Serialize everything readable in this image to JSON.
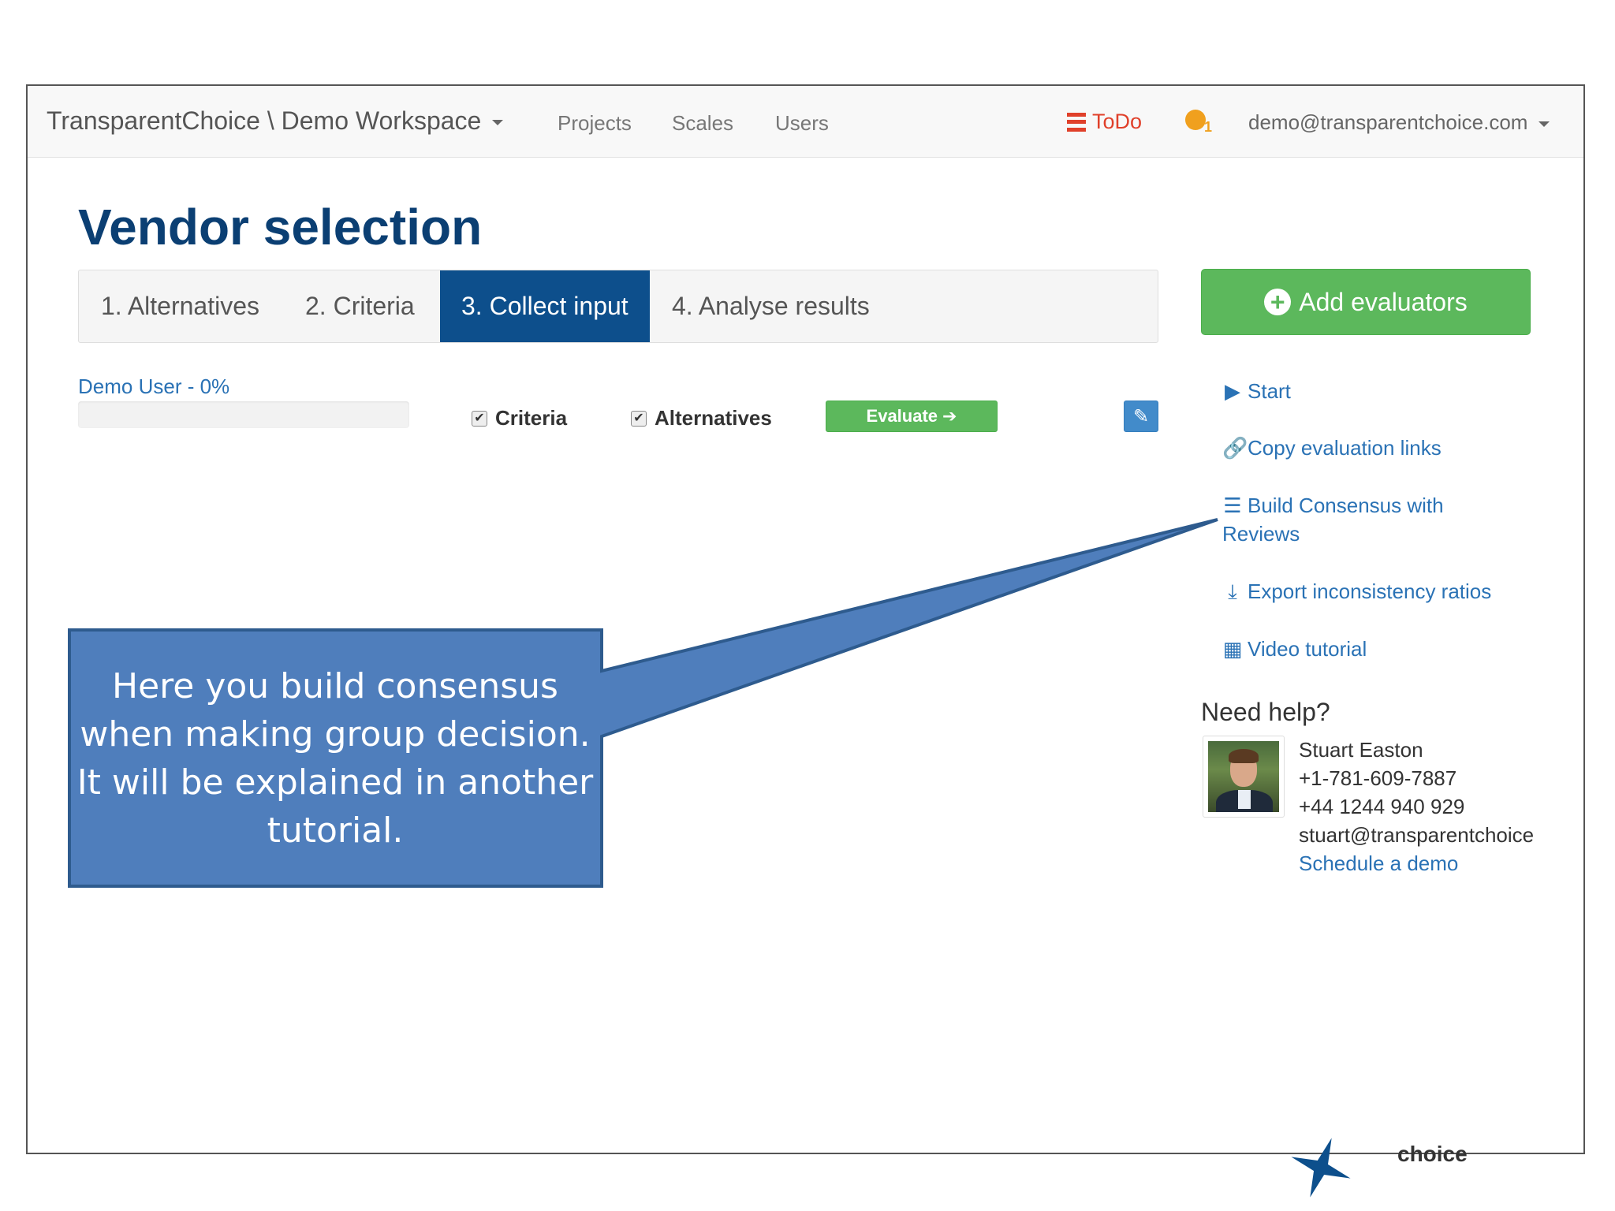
{
  "navbar": {
    "brand": "TransparentChoice \\ Demo Workspace",
    "links": [
      "Projects",
      "Scales",
      "Users"
    ],
    "todo_label": "ToDo",
    "notification_count": "1",
    "user_email": "demo@transparentchoice.com"
  },
  "page_title": "Vendor selection",
  "steps": [
    "1. Alternatives",
    "2. Criteria",
    "3. Collect input",
    "4. Analyse results"
  ],
  "active_step": "3. Collect input",
  "add_evaluators_label": "Add evaluators",
  "evaluator": {
    "name": "Demo User - 0%",
    "progress": 0,
    "criteria_label": "Criteria",
    "criteria_checked": true,
    "alternatives_label": "Alternatives",
    "alternatives_checked": true,
    "evaluate_label": "Evaluate"
  },
  "side_links": [
    {
      "label": "Start",
      "icon": "play-icon"
    },
    {
      "label": "Copy evaluation links",
      "icon": "link-icon"
    },
    {
      "label": "Build Consensus with Reviews",
      "icon": "list-icon"
    },
    {
      "label": "Export inconsistency ratios",
      "icon": "export-icon"
    },
    {
      "label": "Video tutorial",
      "icon": "film-icon"
    }
  ],
  "help": {
    "title": "Need help?",
    "name": "Stuart Easton",
    "phone_us": "+1-781-609-7887",
    "phone_uk": "+44 1244 940 929",
    "email": "stuart@transparentchoice",
    "schedule_label": "Schedule a demo"
  },
  "callout": {
    "text": "Here you build consensus when making group decision. It will be explained in another tutorial."
  },
  "footer_logo_text": "choice",
  "colors": {
    "title": "#0b3f73",
    "active_step": "#0d4f8c",
    "success": "#5cb85c",
    "link": "#2a72b5",
    "todo": "#e0402a",
    "callout_fill": "#4f7ebc",
    "callout_border": "#2e5b8e"
  }
}
